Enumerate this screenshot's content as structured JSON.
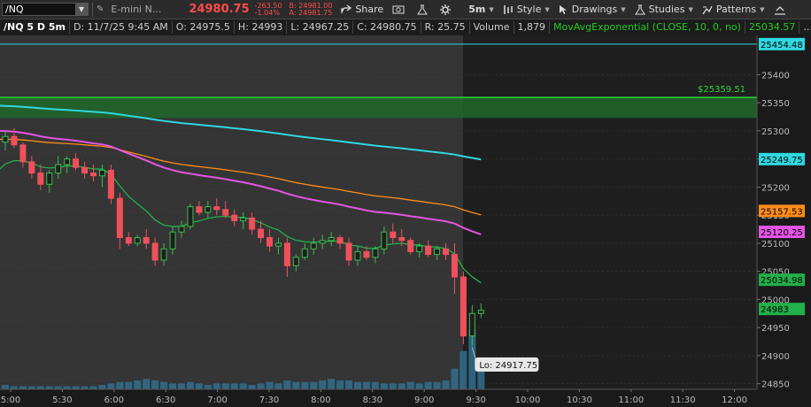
{
  "toolbar": {
    "symbol": "/NQ",
    "description": "E-mini N...",
    "last_price": "24980.75",
    "net_change": "-263.50",
    "pct_change": "-1.04%",
    "bid": "B: 24981.00",
    "ask": "A: 24981.75",
    "share_label": "Share",
    "interval_label": "5m",
    "style_label": "Style",
    "drawings_label": "Drawings",
    "studies_label": "Studies",
    "patterns_label": "Patterns"
  },
  "info_bar": {
    "title": "/NQ 5 D 5m",
    "date": "D: 11/7/25 9:45 AM",
    "open": "O: 24975.5",
    "high": "H: 24993",
    "low": "L: 24967.25",
    "close": "C: 24980.75",
    "range": "R: 25.75",
    "volume_label": "Volume",
    "volume_value": "1,879",
    "study_label": "MovAvgExponential (CLOSE, 10, 0, no)",
    "study_value": "25034.57",
    "more": "..."
  },
  "chart_data": {
    "type": "candlestick",
    "price_axis": {
      "ticks": [
        "25400",
        "25350",
        "25300",
        "25250",
        "25200",
        "25150",
        "25100",
        "25050",
        "25000",
        "24950",
        "24900",
        "24850"
      ],
      "range": [
        24840,
        25470
      ]
    },
    "time_axis": {
      "ticks": [
        "5:00",
        "5:30",
        "6:00",
        "6:30",
        "7:00",
        "7:30",
        "8:00",
        "8:30",
        "9:00",
        "9:30",
        "10:00",
        "10:30",
        "11:00",
        "11:30",
        "12:00"
      ]
    },
    "price_labels": {
      "cyan_level": "25454.48",
      "green_level": "$25359.51",
      "cyan_ma": "25249.75",
      "orange_ma": "25157.53",
      "magenta_ma": "25120.25",
      "green_ema": "25034.98",
      "last": "24983",
      "low_bubble": "Lo: 24917.75"
    },
    "levels": {
      "horizontal_cyan": 25454.48,
      "zone_top": 25359.51,
      "zone_bottom": 25323
    },
    "candles": [
      [
        25280,
        25300,
        25265,
        25290
      ],
      [
        25290,
        25305,
        25270,
        25275
      ],
      [
        25275,
        25280,
        25235,
        25245
      ],
      [
        25245,
        25255,
        25215,
        25225
      ],
      [
        25225,
        25240,
        25195,
        25205
      ],
      [
        25205,
        25230,
        25190,
        25225
      ],
      [
        25225,
        25255,
        25215,
        25240
      ],
      [
        25240,
        25255,
        25225,
        25250
      ],
      [
        25250,
        25260,
        25230,
        25235
      ],
      [
        25235,
        25245,
        25215,
        25225
      ],
      [
        25225,
        25240,
        25210,
        25220
      ],
      [
        25220,
        25240,
        25200,
        25230
      ],
      [
        25230,
        25240,
        25170,
        25180
      ],
      [
        25180,
        25190,
        25090,
        25110
      ],
      [
        25110,
        25120,
        25095,
        25100
      ],
      [
        25100,
        25115,
        25095,
        25110
      ],
      [
        25110,
        25125,
        25090,
        25100
      ],
      [
        25100,
        25110,
        25060,
        25070
      ],
      [
        25070,
        25100,
        25060,
        25090
      ],
      [
        25090,
        25130,
        25080,
        25120
      ],
      [
        25120,
        25140,
        25110,
        25130
      ],
      [
        25130,
        25170,
        25125,
        25165
      ],
      [
        25165,
        25175,
        25150,
        25155
      ],
      [
        25155,
        25175,
        25145,
        25165
      ],
      [
        25165,
        25180,
        25150,
        25160
      ],
      [
        25160,
        25175,
        25145,
        25150
      ],
      [
        25150,
        25160,
        25130,
        25140
      ],
      [
        25140,
        25155,
        25125,
        25145
      ],
      [
        25145,
        25155,
        25115,
        25125
      ],
      [
        25125,
        25140,
        25100,
        25110
      ],
      [
        25110,
        25125,
        25085,
        25095
      ],
      [
        25095,
        25110,
        25080,
        25100
      ],
      [
        25100,
        25110,
        25040,
        25060
      ],
      [
        25060,
        25080,
        25050,
        25075
      ],
      [
        25075,
        25100,
        25070,
        25090
      ],
      [
        25090,
        25110,
        25080,
        25100
      ],
      [
        25100,
        25115,
        25090,
        25105
      ],
      [
        25105,
        25120,
        25095,
        25110
      ],
      [
        25110,
        25115,
        25090,
        25100
      ],
      [
        25100,
        25110,
        25060,
        25070
      ],
      [
        25070,
        25095,
        25060,
        25085
      ],
      [
        25085,
        25095,
        25070,
        25075
      ],
      [
        25075,
        25095,
        25065,
        25090
      ],
      [
        25090,
        25130,
        25080,
        25120
      ],
      [
        25120,
        25135,
        25100,
        25110
      ],
      [
        25110,
        25125,
        25095,
        25105
      ],
      [
        25105,
        25110,
        25080,
        25085
      ],
      [
        25085,
        25100,
        25075,
        25095
      ],
      [
        25095,
        25105,
        25075,
        25080
      ],
      [
        25080,
        25095,
        25070,
        25090
      ],
      [
        25090,
        25100,
        25070,
        25080
      ],
      [
        25080,
        25100,
        25010,
        25040
      ],
      [
        25040,
        25050,
        24920,
        24935
      ],
      [
        24935,
        24990,
        24917.75,
        24975
      ],
      [
        24975,
        24993,
        24967.25,
        24980.75
      ]
    ],
    "volume": [
      3,
      2,
      2,
      2,
      2,
      2,
      2,
      2,
      2,
      2,
      2,
      3,
      4,
      5,
      5,
      6,
      7,
      6,
      5,
      4,
      4,
      5,
      4,
      3,
      4,
      4,
      4,
      4,
      3,
      4,
      5,
      4,
      6,
      5,
      5,
      5,
      6,
      7,
      6,
      6,
      5,
      5,
      5,
      4,
      4,
      4,
      5,
      4,
      5,
      5,
      6,
      14,
      26,
      40,
      18
    ]
  }
}
